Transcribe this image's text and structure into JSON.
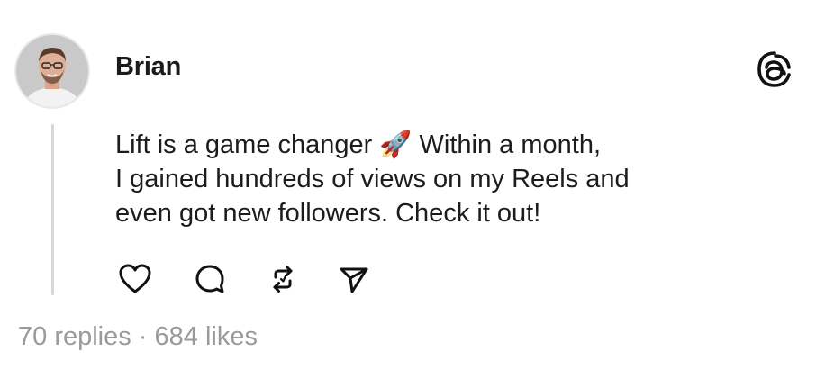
{
  "post": {
    "author": "Brian",
    "text_lines": [
      "Lift is a game changer 🚀 Within a month,",
      "I gained hundreds of views on my Reels and",
      "even got new followers. Check it out!"
    ],
    "stats": {
      "replies": "70 replies",
      "separator": " · ",
      "likes": "684 likes"
    }
  },
  "icons": {
    "avatar": "profile-photo",
    "logo": "threads-logo-icon",
    "like": "heart-icon",
    "reply": "comment-icon",
    "repost": "repost-icon",
    "share": "send-icon"
  },
  "colors": {
    "text": "#1c1c1c",
    "muted": "#9a9a9a",
    "thread_line": "#d7d7d7"
  }
}
